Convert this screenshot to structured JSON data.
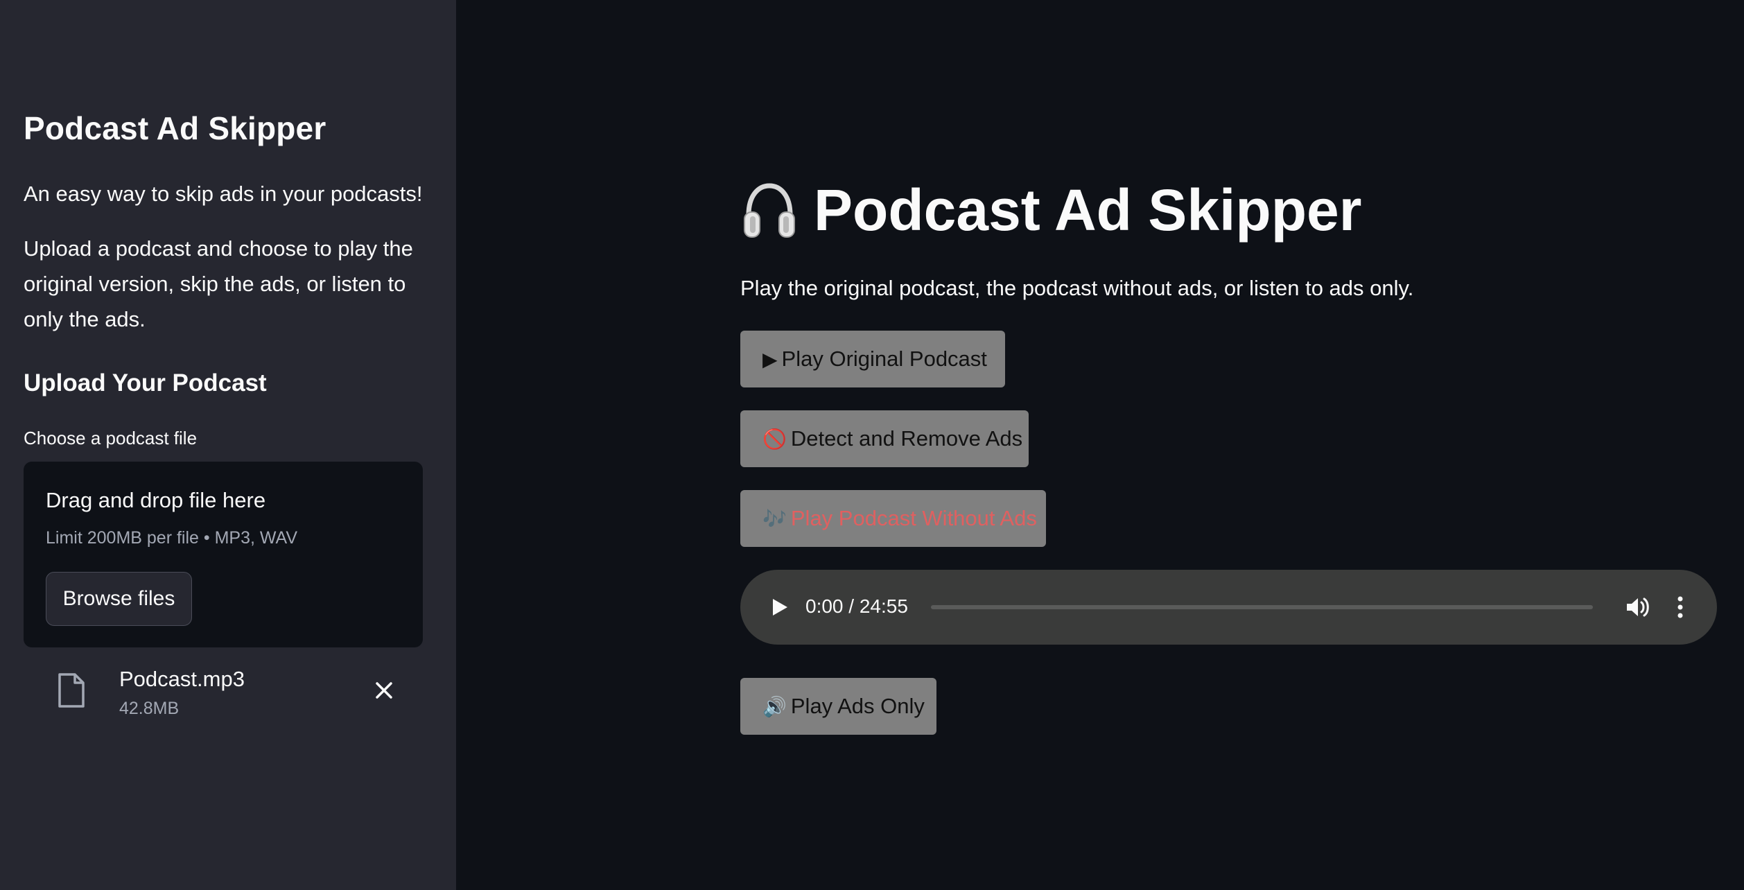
{
  "sidebar": {
    "title": "Podcast Ad Skipper",
    "tagline": "An easy way to skip ads in your podcasts!",
    "description": "Upload a podcast and choose to play the original version, skip the ads, or listen to only the ads.",
    "upload_heading": "Upload Your Podcast",
    "file_label": "Choose a podcast file",
    "dropzone": {
      "title": "Drag and drop file here",
      "limit": "Limit 200MB per file • MP3, WAV",
      "browse_label": "Browse files"
    },
    "uploaded_file": {
      "name": "Podcast.mp3",
      "size": "42.8MB",
      "icon": "file-icon",
      "remove_icon": "close-icon"
    }
  },
  "main": {
    "title": "Podcast Ad Skipper",
    "title_icon": "headphones-icon",
    "description": "Play the original podcast, the podcast without ads, or listen to ads only.",
    "buttons": {
      "play_original": {
        "emoji": "▶",
        "label": "Play Original Podcast"
      },
      "detect_remove": {
        "emoji": "🚫",
        "label": "Detect and Remove Ads"
      },
      "play_without_ads": {
        "emoji": "🎶",
        "label": "Play Podcast Without Ads"
      },
      "play_ads_only": {
        "emoji": "🔊",
        "label": "Play Ads Only"
      }
    },
    "audio_player": {
      "time": "0:00 / 24:55",
      "progress": 0
    }
  },
  "colors": {
    "sidebar_bg": "#262730",
    "main_bg": "#0e1117",
    "button_bg": "#808080",
    "disabled_label": "#e06060",
    "player_bg": "#3a3b3a"
  }
}
